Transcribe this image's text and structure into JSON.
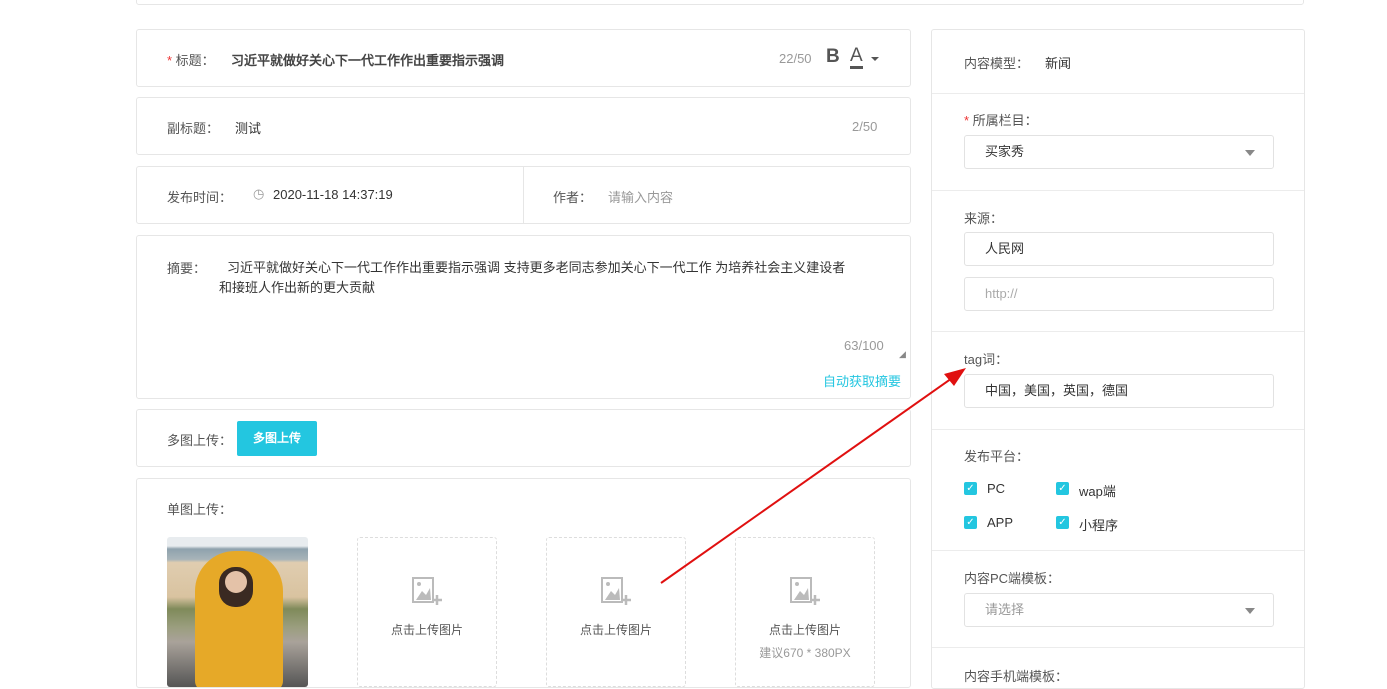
{
  "title": {
    "label": "标题：",
    "value": "习近平就做好关心下一代工作作出重要指示强调",
    "count": "22/50",
    "bold": "B",
    "color": "A"
  },
  "subtitle": {
    "label": "副标题：",
    "value": "测试",
    "count": "2/50"
  },
  "publish_time": {
    "label": "发布时间：",
    "value": "2020-11-18 14:37:19"
  },
  "author": {
    "label": "作者：",
    "placeholder": "请输入内容"
  },
  "summary": {
    "label": "摘要：",
    "line1": "习近平就做好关心下一代工作作出重要指示强调 支持更多老同志参加关心下一代工作 为培养社会主义建设者",
    "line2": "和接班人作出新的更大贡献",
    "count": "63/100",
    "auto_link": "自动获取摘要"
  },
  "multi_upload": {
    "label": "多图上传：",
    "button": "多图上传"
  },
  "single_upload": {
    "label": "单图上传：",
    "slot_label": "点击上传图片",
    "hint": "建议670 * 380PX"
  },
  "sidebar": {
    "model_label": "内容模型：",
    "model_value": "新闻",
    "column_label": "所属栏目：",
    "column_value": "买家秀",
    "source_label": "来源：",
    "source_value": "人民网",
    "source_url_placeholder": "http://",
    "tag_label": "tag词：",
    "tag_value": "中国，美国，英国，德国",
    "platform_label": "发布平台：",
    "platforms": [
      {
        "label": "PC",
        "checked": true
      },
      {
        "label": "wap端",
        "checked": true
      },
      {
        "label": "APP",
        "checked": true
      },
      {
        "label": "小程序",
        "checked": true
      }
    ],
    "pc_template_label": "内容PC端模板：",
    "pc_template_placeholder": "请选择",
    "mobile_template_label": "内容手机端模板："
  },
  "colors": {
    "accent": "#23c6e0",
    "required": "#e33333",
    "arrow": "#e01010"
  }
}
